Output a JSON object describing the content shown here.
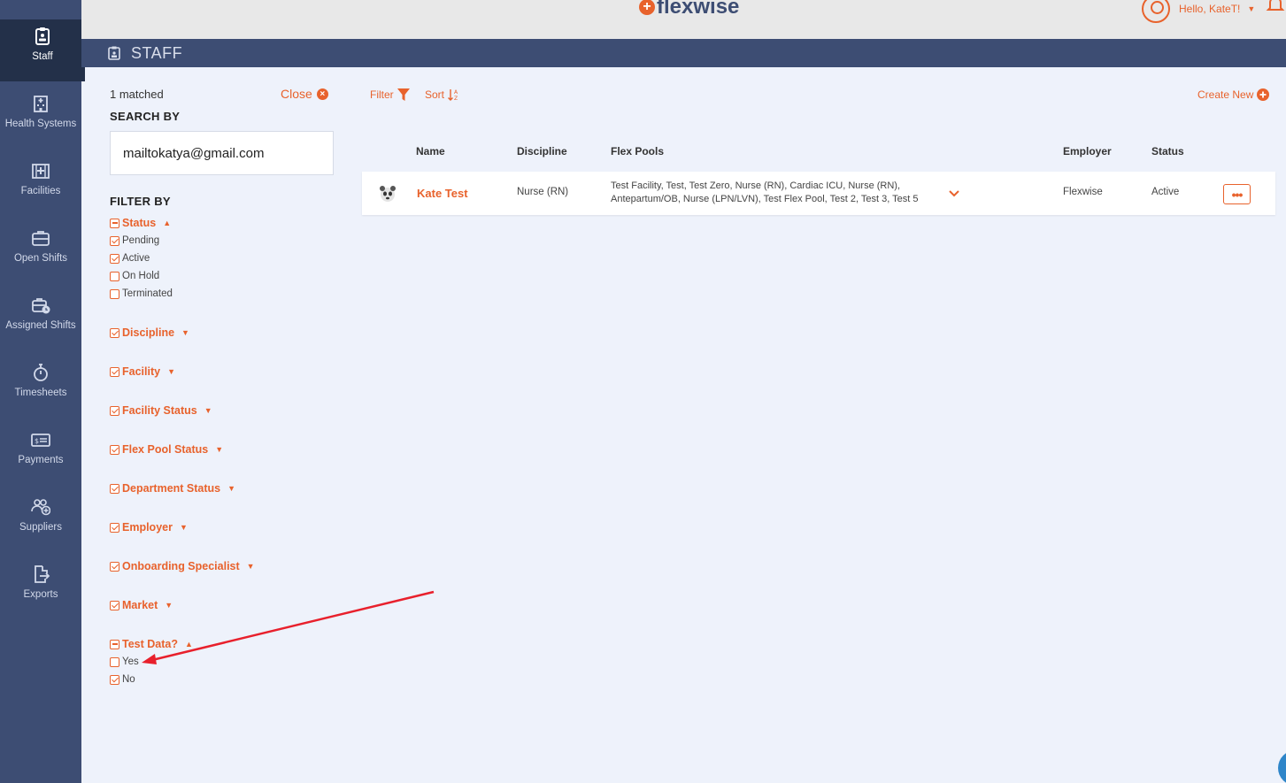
{
  "sidebar": {
    "items": [
      {
        "label": "Staff",
        "icon": "clipboard-id-icon"
      },
      {
        "label": "Health Systems",
        "icon": "hospital-building-icon"
      },
      {
        "label": "Facilities",
        "icon": "facility-icon"
      },
      {
        "label": "Open Shifts",
        "icon": "briefcase-icon"
      },
      {
        "label": "Assigned Shifts",
        "icon": "briefcase-clock-icon"
      },
      {
        "label": "Timesheets",
        "icon": "stopwatch-icon"
      },
      {
        "label": "Payments",
        "icon": "money-bill-icon"
      },
      {
        "label": "Suppliers",
        "icon": "users-plus-icon"
      },
      {
        "label": "Exports",
        "icon": "file-export-icon"
      }
    ]
  },
  "topbar": {
    "logo_text": "flexwise",
    "greeting": "Hello, KateT!",
    "accent_color": "#e8622c",
    "nav_color": "#3d4d73"
  },
  "page": {
    "title": "STAFF"
  },
  "filters": {
    "matched": "1 matched",
    "close_label": "Close",
    "search_by_label": "SEARCH BY",
    "search_value": "mailtokatya@gmail.com",
    "filter_by_label": "FILTER BY",
    "status": {
      "label": "Status",
      "options": [
        {
          "label": "Pending",
          "checked": true
        },
        {
          "label": "Active",
          "checked": true
        },
        {
          "label": "On Hold",
          "checked": false
        },
        {
          "label": "Terminated",
          "checked": false
        }
      ]
    },
    "groups": [
      "Discipline",
      "Facility",
      "Facility Status",
      "Flex Pool Status",
      "Department Status",
      "Employer",
      "Onboarding Specialist",
      "Market"
    ],
    "test_data": {
      "label": "Test Data?",
      "options": [
        {
          "label": "Yes",
          "checked": false
        },
        {
          "label": "No",
          "checked": true
        }
      ]
    }
  },
  "toolbar": {
    "filter_label": "Filter",
    "sort_label": "Sort",
    "create_label": "Create New"
  },
  "table": {
    "columns": [
      "Name",
      "Discipline",
      "Flex Pools",
      "Employer",
      "Status"
    ],
    "rows": [
      {
        "name": "Kate Test",
        "discipline": "Nurse (RN)",
        "flex_pools_line1": "Test Facility, Test, Test Zero, Nurse (RN), Cardiac ICU, Nurse (RN),",
        "flex_pools_line2": "Antepartum/OB, Nurse (LPN/LVN), Test Flex Pool, Test 2, Test 3, Test 5",
        "employer": "Flexwise",
        "status": "Active",
        "more_label": "•••"
      }
    ]
  }
}
